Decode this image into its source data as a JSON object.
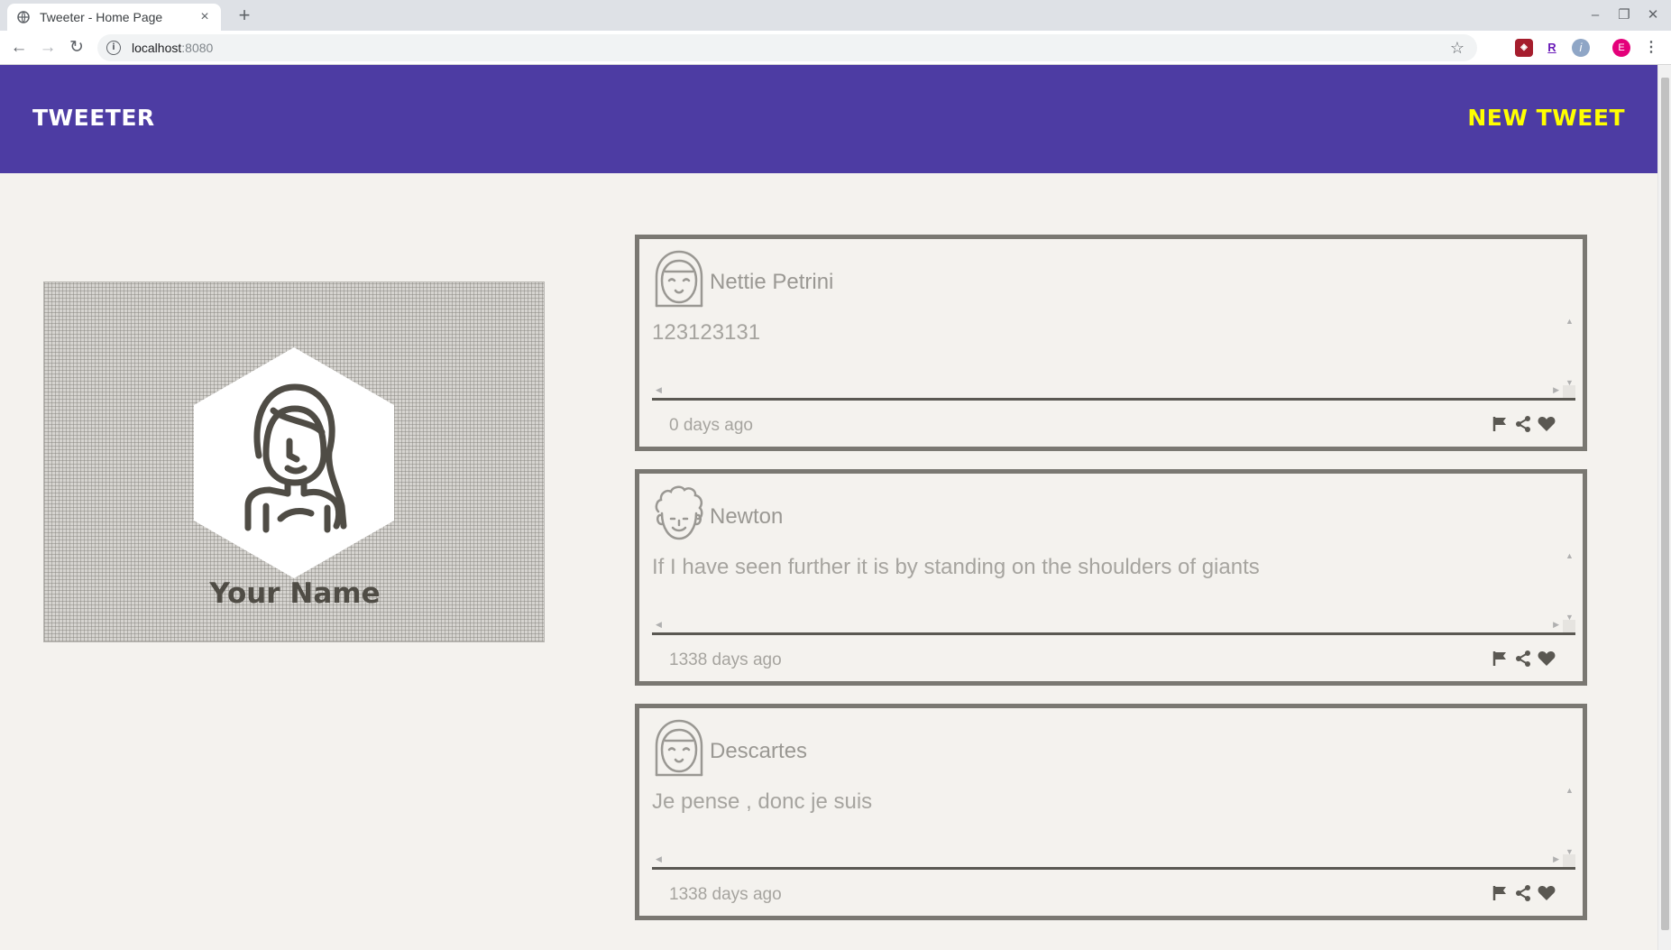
{
  "browser": {
    "tab_title": "Tweeter - Home Page",
    "url_host": "localhost",
    "url_port": ":8080",
    "profile_initial": "E"
  },
  "navbar": {
    "brand": "TWEETER",
    "new_tweet": "NEW TWEET",
    "color": "#4d3ca3",
    "accent": "#ffff00"
  },
  "profile": {
    "name": "Your Name"
  },
  "tweets": [
    {
      "author": "Nettie Petrini",
      "avatar": "woman-avatar-icon",
      "text": "123123131",
      "time": "0 days ago"
    },
    {
      "author": "Newton",
      "avatar": "curly-hair-man-avatar-icon",
      "text": "If I have seen further it is by standing on the shoulders of giants",
      "time": "1338 days ago"
    },
    {
      "author": "Descartes",
      "avatar": "woman-avatar-icon",
      "text": "Je pense , donc je suis",
      "time": "1338 days ago"
    }
  ]
}
